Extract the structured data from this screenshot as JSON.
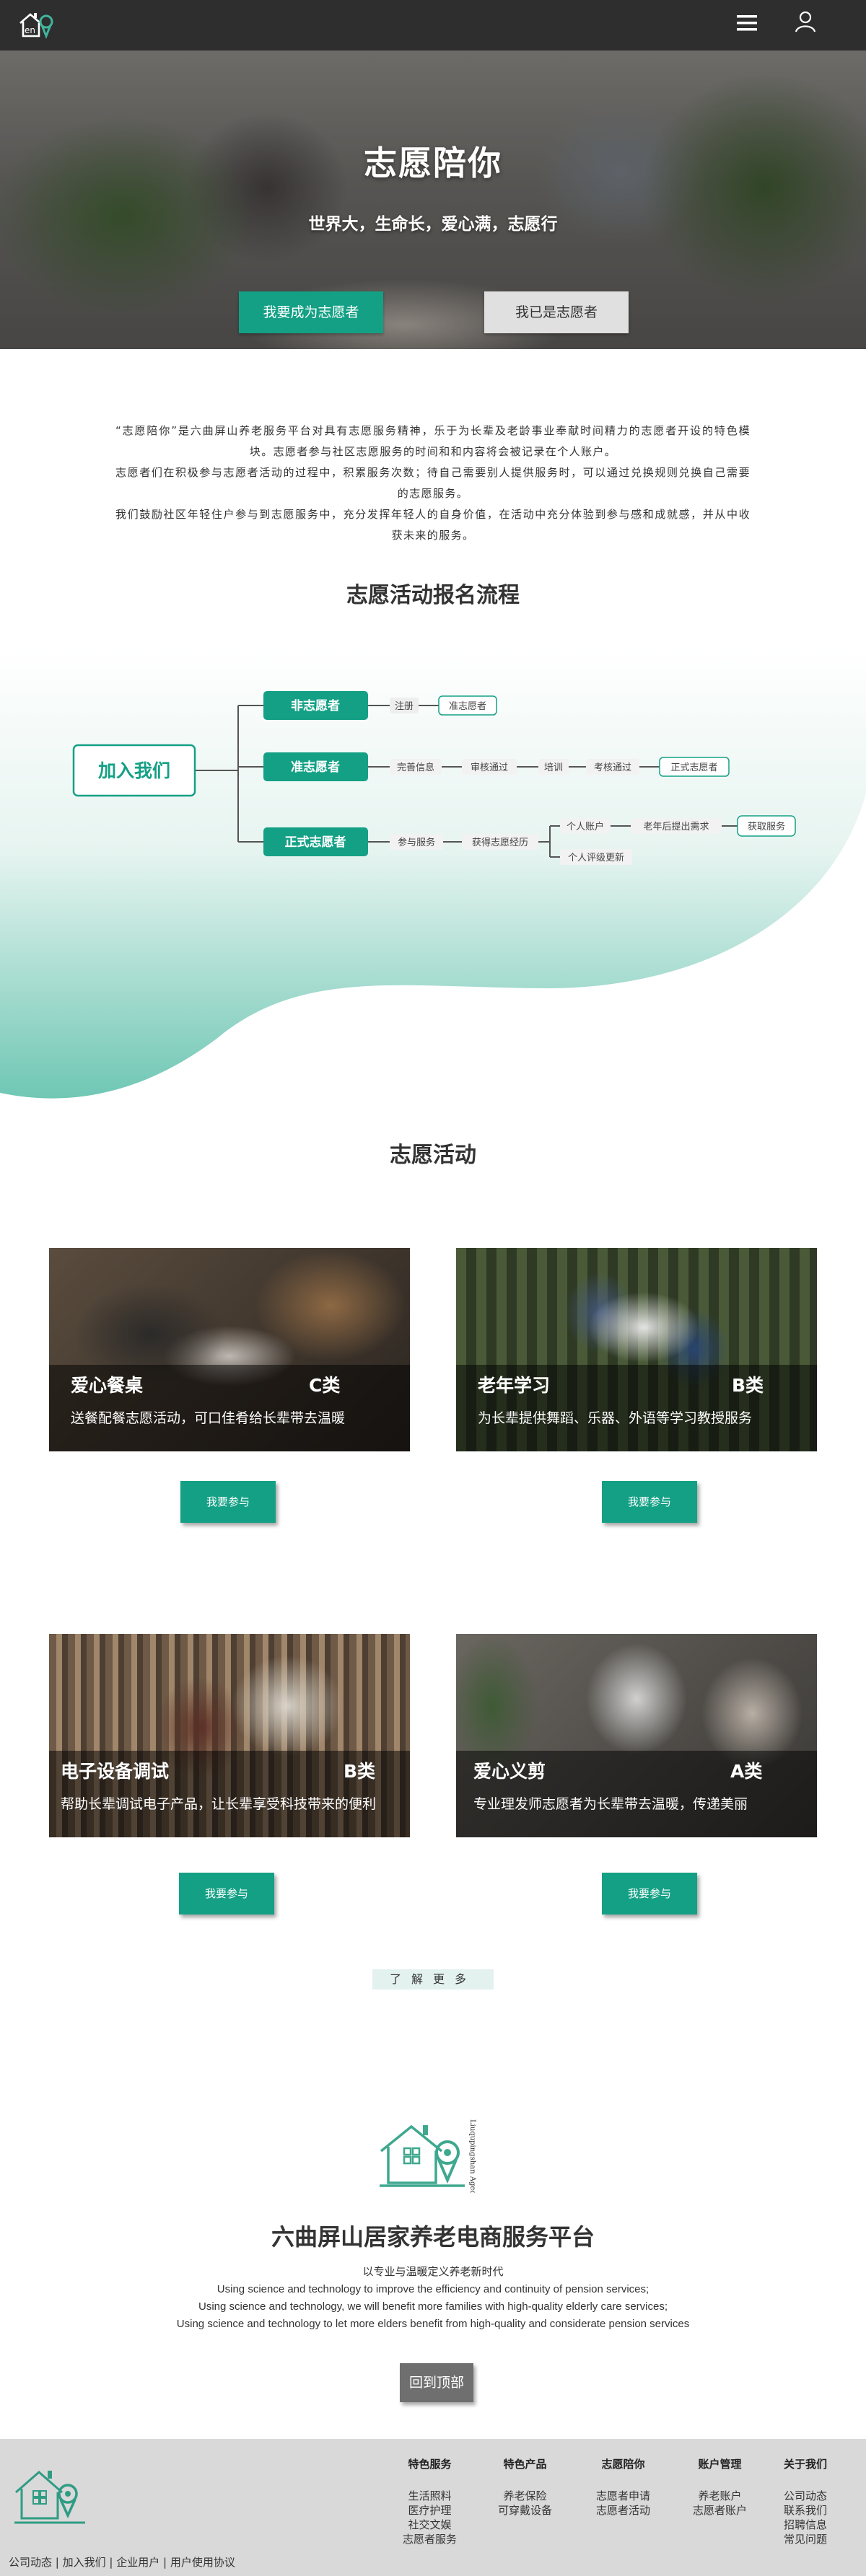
{
  "header": {
    "logo_text": "en",
    "menu_icon": "hamburger-menu-icon",
    "user_icon": "user-icon"
  },
  "hero": {
    "title": "志愿陪你",
    "subtitle": "世界大，生命长，爱心满，志愿行",
    "btn_become": "我要成为志愿者",
    "btn_already": "我已是志愿者"
  },
  "intro": {
    "p1": "“志愿陪你”是六曲屏山养老服务平台对具有志愿服务精神，乐于为长辈及老龄事业奉献时间精力的志愿者开设的特色模块。志愿者参与社区志愿服务的时间和和内容将会被记录在个人账户。",
    "p2": "志愿者们在积极参与志愿者活动的过程中，积累服务次数；待自己需要别人提供服务时，可以通过兑换规则兑换自己需要的志愿服务。",
    "p3": "我们鼓励社区年轻住户参与到志愿服务中，充分发挥年轻人的自身价值，在活动中充分体验到参与感和成就感，并从中收获未来的服务。"
  },
  "process": {
    "title": "志愿活动报名流程",
    "root": "加入我们",
    "branches": [
      {
        "label": "非志愿者",
        "steps": [
          "注册",
          "准志愿者"
        ]
      },
      {
        "label": "准志愿者",
        "steps": [
          "完善信息",
          "审核通过",
          "培训",
          "考核通过",
          "正式志愿者"
        ]
      },
      {
        "label": "正式志愿者",
        "steps": [
          "参与服务",
          "获得志愿经历"
        ],
        "sub_upper": [
          "个人账户",
          "老年后提出需求",
          "获取服务"
        ],
        "sub_lower": "个人评级更新"
      }
    ]
  },
  "activities": {
    "title": "志愿活动",
    "join_label": "我要参与",
    "more_label": "了解更多",
    "cards": [
      {
        "title": "爱心餐桌",
        "class": "C类",
        "desc": "送餐配餐志愿活动，可口佳肴给长辈带去温暖"
      },
      {
        "title": "老年学习",
        "class": "B类",
        "desc": "为长辈提供舞蹈、乐器、外语等学习教授服务"
      },
      {
        "title": "电子设备调试",
        "class": "B类",
        "desc": "帮助长辈调试电子产品，让长辈享受科技带来的便利"
      },
      {
        "title": "爱心义剪",
        "class": "A类",
        "desc": "专业理发师志愿者为长辈带去温暖，传递美丽"
      }
    ]
  },
  "platform": {
    "logo_side_text": "Liuqupingshan Aged Service",
    "title": "六曲屏山居家养老电商服务平台",
    "line1": "以专业与温暖定义养老新时代",
    "line2": "Using science and technology to improve the efficiency and continuity of pension services;",
    "line3": "Using science and technology, we will benefit more families with high-quality elderly care services;",
    "line4": "Using science and technology to let more elders benefit from high-quality and considerate pension services",
    "back_to_top": "回到顶部"
  },
  "footer": {
    "columns": [
      {
        "title": "特色服务",
        "items": [
          "生活照料",
          "医疗护理",
          "社交文娱",
          "志愿者服务"
        ]
      },
      {
        "title": "特色产品",
        "items": [
          "养老保险",
          "可穿戴设备"
        ]
      },
      {
        "title": "志愿陪你",
        "items": [
          "志愿者申请",
          "志愿者活动"
        ]
      },
      {
        "title": "账户管理",
        "items": [
          "养老账户",
          "志愿者账户"
        ]
      },
      {
        "title": "关于我们",
        "items": [
          "公司动态",
          "联系我们",
          "招聘信息",
          "常见问题"
        ]
      }
    ],
    "bottom_links": [
      "公司动态",
      "加入我们",
      "企业用户",
      "用户使用协议"
    ]
  },
  "colors": {
    "accent": "#14a085",
    "dark_bar": "#2e2e2e",
    "footer_bg": "#d9d9d9",
    "wave_top": "#ffffff",
    "wave_bottom": "#6fc7b4"
  }
}
